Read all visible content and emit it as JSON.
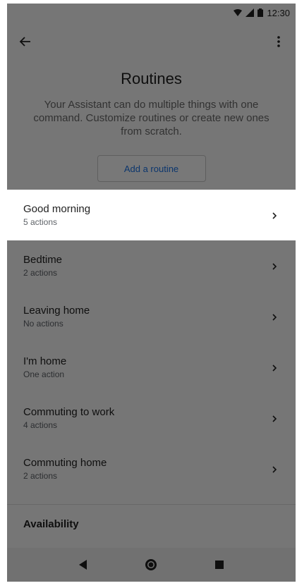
{
  "status_bar": {
    "time": "12:30",
    "icons": [
      "wifi-icon",
      "signal-icon",
      "battery-icon"
    ]
  },
  "app_bar": {
    "back_icon": "arrow-back-icon",
    "menu_icon": "more-vert-icon"
  },
  "header": {
    "title": "Routines",
    "description": "Your Assistant can do multiple things with one command. Customize routines or create new ones from scratch."
  },
  "add_routine_label": "Add a routine",
  "routines": [
    {
      "name": "Good morning",
      "count": "5 actions",
      "highlighted": true
    },
    {
      "name": "Bedtime",
      "count": "2 actions",
      "highlighted": false
    },
    {
      "name": "Leaving home",
      "count": "No actions",
      "highlighted": false
    },
    {
      "name": "I'm home",
      "count": "One action",
      "highlighted": false
    },
    {
      "name": "Commuting to work",
      "count": "4 actions",
      "highlighted": false
    },
    {
      "name": "Commuting home",
      "count": "2 actions",
      "highlighted": false
    }
  ],
  "availability_label": "Availability",
  "nav_bar": {
    "icons": [
      "back-triangle-icon",
      "home-circle-icon",
      "recents-square-icon"
    ]
  },
  "colors": {
    "accent": "#1a73e8",
    "scrim": "#000000"
  }
}
